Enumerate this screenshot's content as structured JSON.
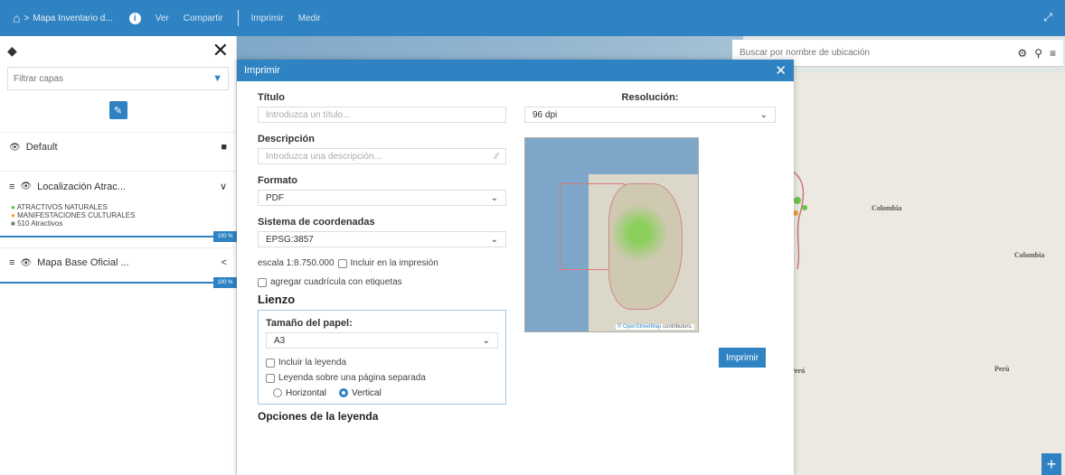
{
  "topbar": {
    "breadcrumb": "Mapa Inventario d...",
    "menu": [
      "Ver",
      "Compartir",
      "Imprimir",
      "Medir"
    ]
  },
  "search": {
    "placeholder": "Buscar por nombre de ubicación"
  },
  "layers": {
    "filter_placeholder": "Filtrar capas",
    "groups": [
      {
        "label": "Default"
      },
      {
        "label": "Localización Atrac...",
        "legend": [
          "ATRACTIVOS NATURALES",
          "MANIFESTACIONES CULTURALES",
          "510 Atractivos"
        ],
        "opacity": "100 %"
      },
      {
        "label": "Mapa Base Oficial ...",
        "opacity": "100 %"
      }
    ]
  },
  "map_labels": [
    "Colombia",
    "Colombia",
    "Perú",
    "Perú"
  ],
  "modal": {
    "title": "Imprimir",
    "titulo_label": "Título",
    "titulo_placeholder": "Introduzca un título...",
    "descripcion_label": "Descripción",
    "descripcion_placeholder": "Introduzca una descripción...",
    "formato_label": "Formato",
    "formato_value": "PDF",
    "sistema_label": "Sistema de coordenadas",
    "sistema_value": "EPSG:3857",
    "escala_text": "escala 1:8.750.000",
    "incluir_impresion": "Incluir en la impresión",
    "cuadricula": "agregar cuadrícula con etiquetas",
    "lienzo_label": "Lienzo",
    "papel_label": "Tamaño del papel:",
    "papel_value": "A3",
    "incluir_leyenda": "Incluir la leyenda",
    "leyenda_separada": "Leyenda sobre una página separada",
    "horizontal": "Horizontal",
    "vertical": "Vertical",
    "opciones_leyenda": "Opciones de la leyenda",
    "resolucion_label": "Resolución:",
    "resolucion_value": "96 dpi",
    "copyright_link": "© OpenStreetMap",
    "copyright_rest": "contributors.",
    "print_button": "Imprimir"
  }
}
